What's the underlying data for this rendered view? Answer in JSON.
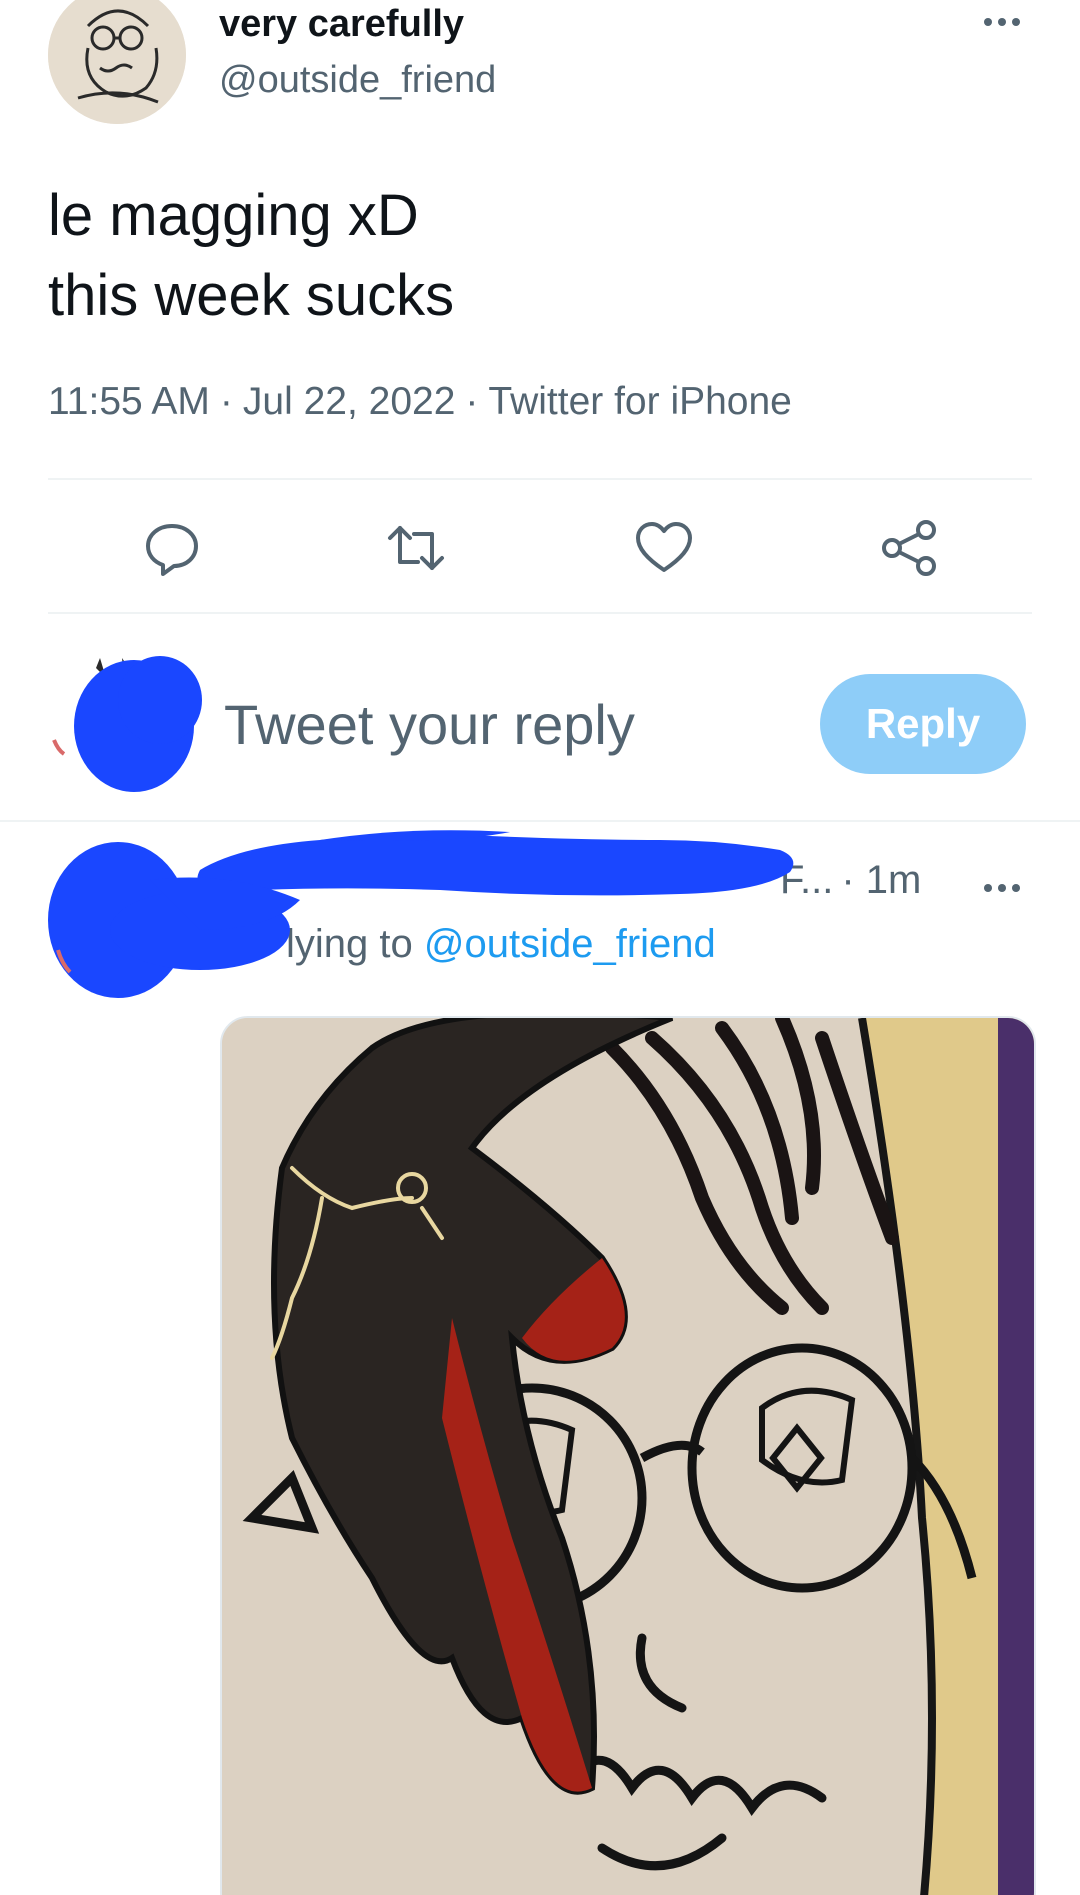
{
  "tweet": {
    "author": {
      "display_name": "very carefully",
      "handle": "@outside_friend"
    },
    "text_lines": [
      "le magging xD",
      "this week sucks"
    ],
    "meta": {
      "time": "11:55 AM",
      "date": "Jul 22, 2022",
      "source": "Twitter for iPhone",
      "separator": "·"
    },
    "actions": [
      "reply-icon",
      "retweet-icon",
      "like-icon",
      "share-icon"
    ]
  },
  "composer": {
    "placeholder": "Tweet your reply",
    "button_label": "Reply"
  },
  "reply": {
    "truncated_name": "F...",
    "time_label": "· 1m",
    "replying_prefix": "lying to",
    "replying_to": "@outside_friend"
  },
  "colors": {
    "text_primary": "#0f1419",
    "text_secondary": "#536471",
    "link": "#1d9bf0",
    "reply_button_disabled": "#8ecdf8",
    "redaction_scribble": "#1a47ff"
  }
}
